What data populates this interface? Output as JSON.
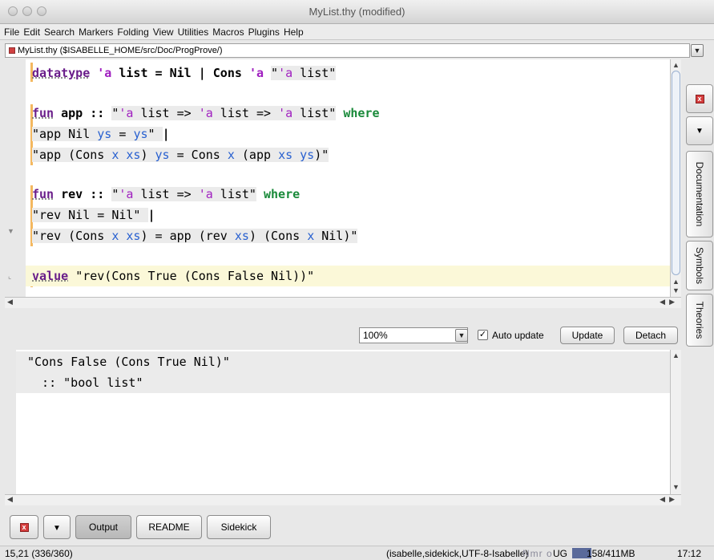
{
  "window": {
    "title": "MyList.thy (modified)"
  },
  "menu": [
    "File",
    "Edit",
    "Search",
    "Markers",
    "Folding",
    "View",
    "Utilities",
    "Macros",
    "Plugins",
    "Help"
  ],
  "buffer": {
    "path": "MyList.thy ($ISABELLE_HOME/src/Doc/ProgProve/)"
  },
  "editor": {
    "l1": {
      "kw": "datatype",
      "t1": "'a",
      "kw2": "list = Nil |",
      "kw3": "Cons",
      "t2": "'a",
      "s1": "\"",
      "t3": "'a",
      "s2": " list\""
    },
    "l3": {
      "kw": "fun",
      "name": "app ::",
      "s1": "\"",
      "t1": "'a",
      "s2": " list => ",
      "t2": "'a",
      "s3": " list => ",
      "t3": "'a",
      "s4": " list\"",
      "where": "where"
    },
    "l4": {
      "a": "\"app Nil ",
      "v1": "ys",
      "b": " = ",
      "v2": "ys",
      "c": "\" ",
      "cur": "|"
    },
    "l5": {
      "a": "\"app (Cons ",
      "v1": "x",
      "sp1": " ",
      "v2": "xs",
      "b": ") ",
      "v3": "ys",
      "c": " = Cons ",
      "v4": "x",
      "d": " (app ",
      "v5": "xs",
      "sp2": " ",
      "v6": "ys",
      "e": ")\""
    },
    "l7": {
      "kw": "fun",
      "name": "rev ::",
      "s1": "\"",
      "t1": "'a",
      "s2": " list => ",
      "t2": "'a",
      "s3": " list\"",
      "where": "where"
    },
    "l8": {
      "a": "\"rev Nil = Nil\" ",
      "cur": "|"
    },
    "l9": {
      "a": "\"rev (Cons ",
      "v1": "x",
      "sp1": " ",
      "v2": "xs",
      "b": ") = app (rev ",
      "v3": "xs",
      "c": ") (Cons ",
      "v4": "x",
      "d": " Nil)\""
    },
    "l11": {
      "kw": "value",
      "s": "\"rev(Cons True (Cons False Nil))\""
    }
  },
  "toolbar": {
    "zoom": "100%",
    "auto_update_checked": true,
    "auto_update_label": "Auto update",
    "update_label": "Update",
    "detach_label": "Detach"
  },
  "output": {
    "line1": "\"Cons False (Cons True Nil)\"",
    "line2": "  :: \"bool list\""
  },
  "side_tabs": [
    "Documentation",
    "Symbols",
    "Theories"
  ],
  "bottom_tabs": [
    "Output",
    "README",
    "Sidekick"
  ],
  "status": {
    "position": "15,21 (336/360)",
    "mode": "(isabelle,sidekick,UTF-8-Isabelle)",
    "flags": "Nmr o",
    "memory_prefix": "UG",
    "memory": "158/411MB",
    "clock": "17:12"
  },
  "icons": {
    "close": "close-icon",
    "dropdown": "chevron-down-icon"
  },
  "colors": {
    "keyword_purple": "#6a1e8a",
    "keyword_green": "#1a8a3a",
    "type_var": "#a020c0",
    "free_var": "#2860d0",
    "highlight_line": "#fbf8d8"
  }
}
